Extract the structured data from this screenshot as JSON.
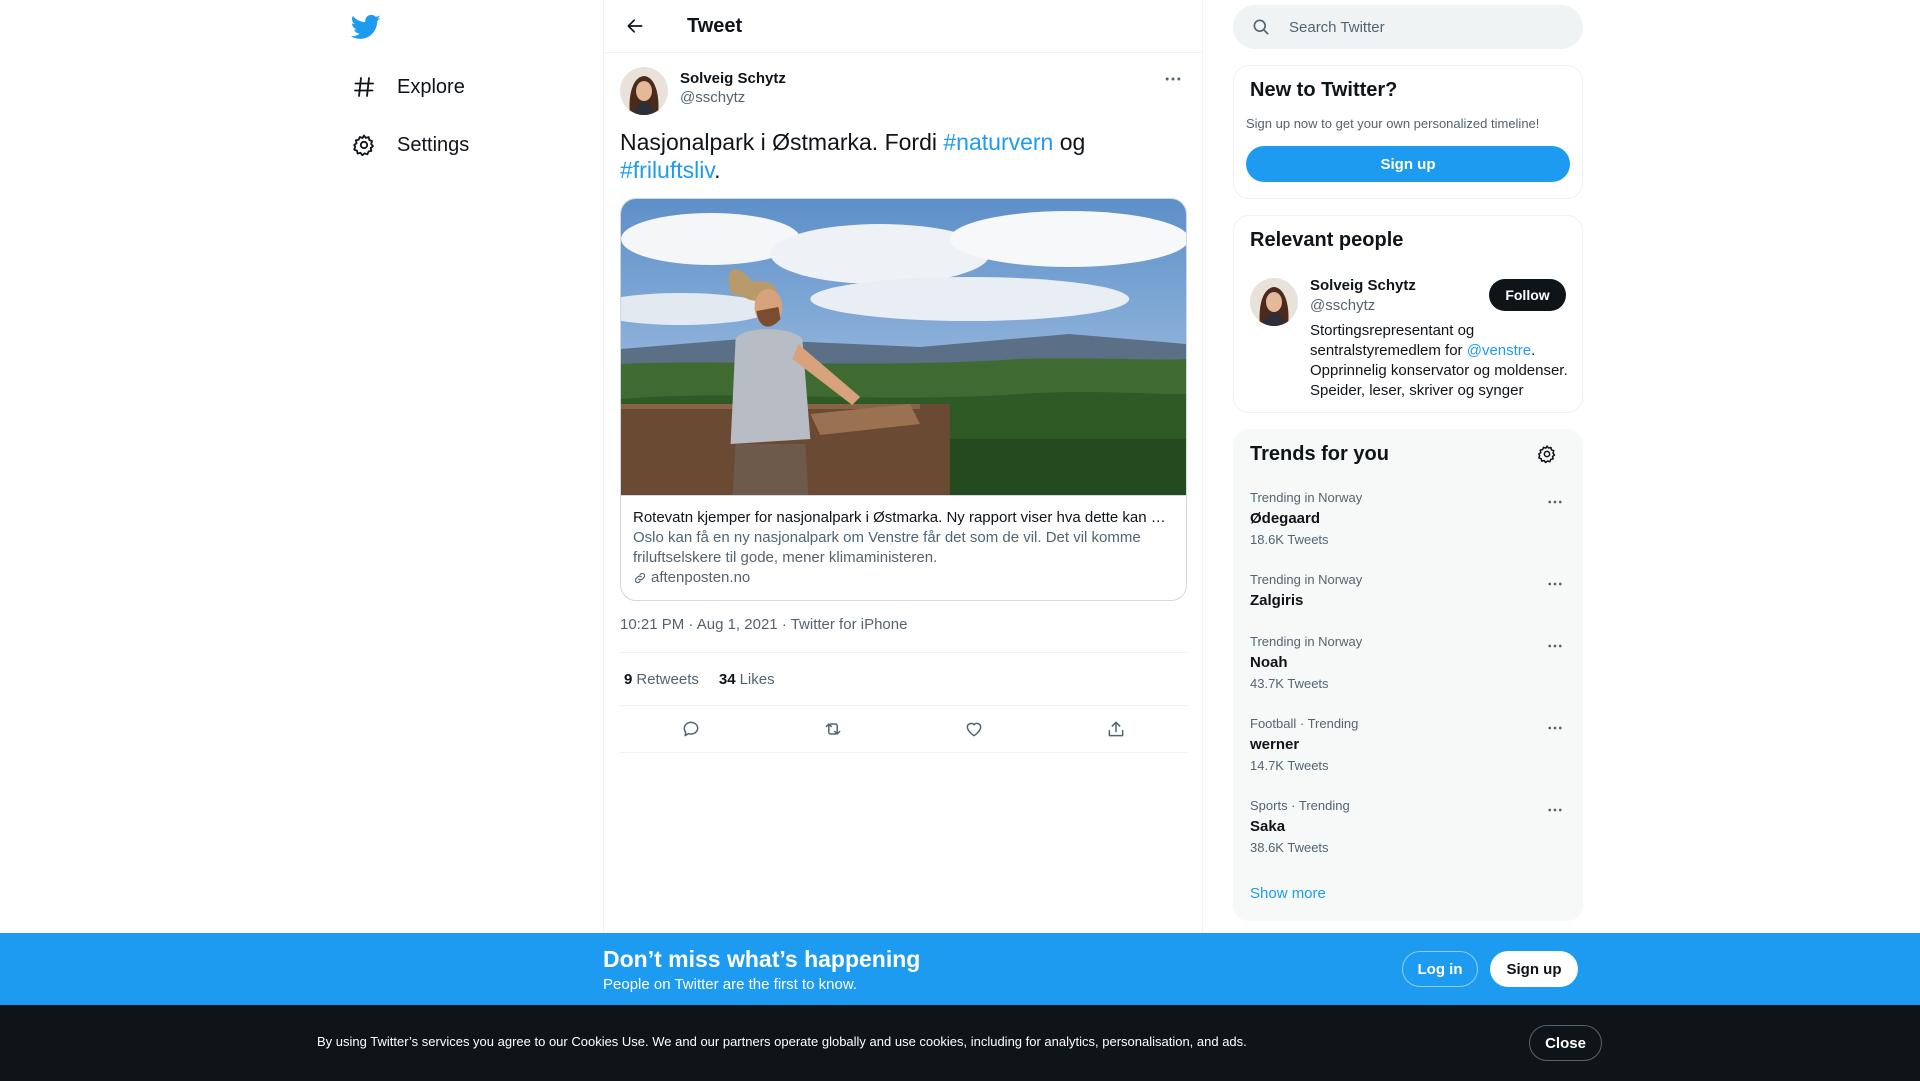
{
  "nav": {
    "items": [
      {
        "label": "Explore",
        "icon": "hashtag-icon"
      },
      {
        "label": "Settings",
        "icon": "gear-icon"
      }
    ]
  },
  "header": {
    "title": "Tweet"
  },
  "tweet": {
    "author_name": "Solveig Schytz",
    "author_handle": "@sschytz",
    "text_part1": "Nasjonalpark i Østmarka. Fordi ",
    "hashtag1": "#naturvern",
    "text_part2": " og",
    "hashtag2": "#friluftsliv",
    "text_part3": ".",
    "card": {
      "title": "Rotevatn kjemper for nasjonalpark i Østmarka. Ny rapport viser hva dette kan bety",
      "description": "Oslo kan få en ny nasjonalpark om Venstre får det som de vil. Det vil komme friluftselskere til gode, mener klimaministeren.",
      "domain": "aftenposten.no"
    },
    "time": "10:21 PM",
    "date": "Aug 1, 2021",
    "source": "Twitter for iPhone",
    "retweets": "9",
    "retweets_label": "Retweets",
    "likes": "34",
    "likes_label": "Likes"
  },
  "search": {
    "placeholder": "Search Twitter"
  },
  "new_to_twitter": {
    "title": "New to Twitter?",
    "subtitle": "Sign up now to get your own personalized timeline!",
    "button": "Sign up"
  },
  "relevant_people": {
    "title": "Relevant people",
    "name": "Solveig Schytz",
    "handle": "@sschytz",
    "follow": "Follow",
    "bio_part1": "Stortingsrepresentant og sentralstyremedlem for ",
    "bio_mention": "@venstre",
    "bio_part2": ". Opprinnelig konservator og moldenser. Speider, leser, skriver og synger"
  },
  "trends": {
    "title": "Trends for you",
    "items": [
      {
        "context": "Trending in Norway",
        "name": "Ødegaard",
        "count": "18.6K Tweets"
      },
      {
        "context": "Trending in Norway",
        "name": "Zalgiris",
        "count": ""
      },
      {
        "context": "Trending in Norway",
        "name": "Noah",
        "count": "43.7K Tweets"
      },
      {
        "context": "Football · Trending",
        "name": "werner",
        "count": "14.7K Tweets"
      },
      {
        "context": "Sports · Trending",
        "name": "Saka",
        "count": "38.6K Tweets"
      }
    ],
    "show_more": "Show more"
  },
  "banner": {
    "title": "Don’t miss what’s happening",
    "subtitle": "People on Twitter are the first to know.",
    "login": "Log in",
    "signup": "Sign up"
  },
  "cookie": {
    "text": "By using Twitter’s services you agree to our Cookies Use. We and our partners operate globally and use cookies, including for analytics, personalisation, and ads.",
    "close": "Close"
  },
  "colors": {
    "accent": "#1d9bf0",
    "text": "#0f1419",
    "secondary": "#536471",
    "cookie_bg": "#0f1419"
  }
}
